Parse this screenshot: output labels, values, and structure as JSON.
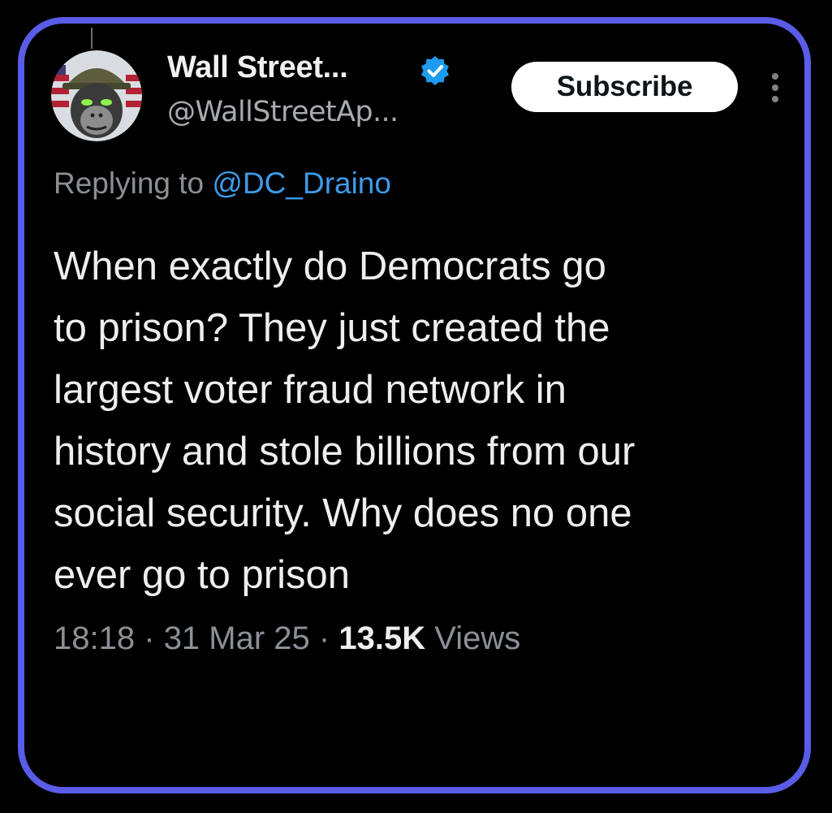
{
  "post": {
    "author": {
      "display_name": "Wall Street...",
      "handle": "@WallStreetAp...",
      "verified": true,
      "avatar": "ape-with-helmet-avatar"
    },
    "subscribe_label": "Subscribe",
    "more_icon": "vertical-ellipsis-icon",
    "replying_to": {
      "prefix": "Replying to",
      "mention": "@DC_Draino"
    },
    "text_lines": [
      "When exactly do Democrats go",
      "to prison? They just created the",
      "largest voter fraud network in",
      "history and stole billions from our",
      "social security. Why does no one",
      "ever go to prison"
    ],
    "time": "18:18",
    "date": "31 Mar 25",
    "views_count": "13.5K",
    "views_label": "Views",
    "separator": "·"
  },
  "colors": {
    "background": "#000000",
    "frame_border": "#5a5ce8",
    "verified_blue": "#1d9bf0",
    "mention_blue": "#3d9be9",
    "muted_text": "#8b9096"
  }
}
